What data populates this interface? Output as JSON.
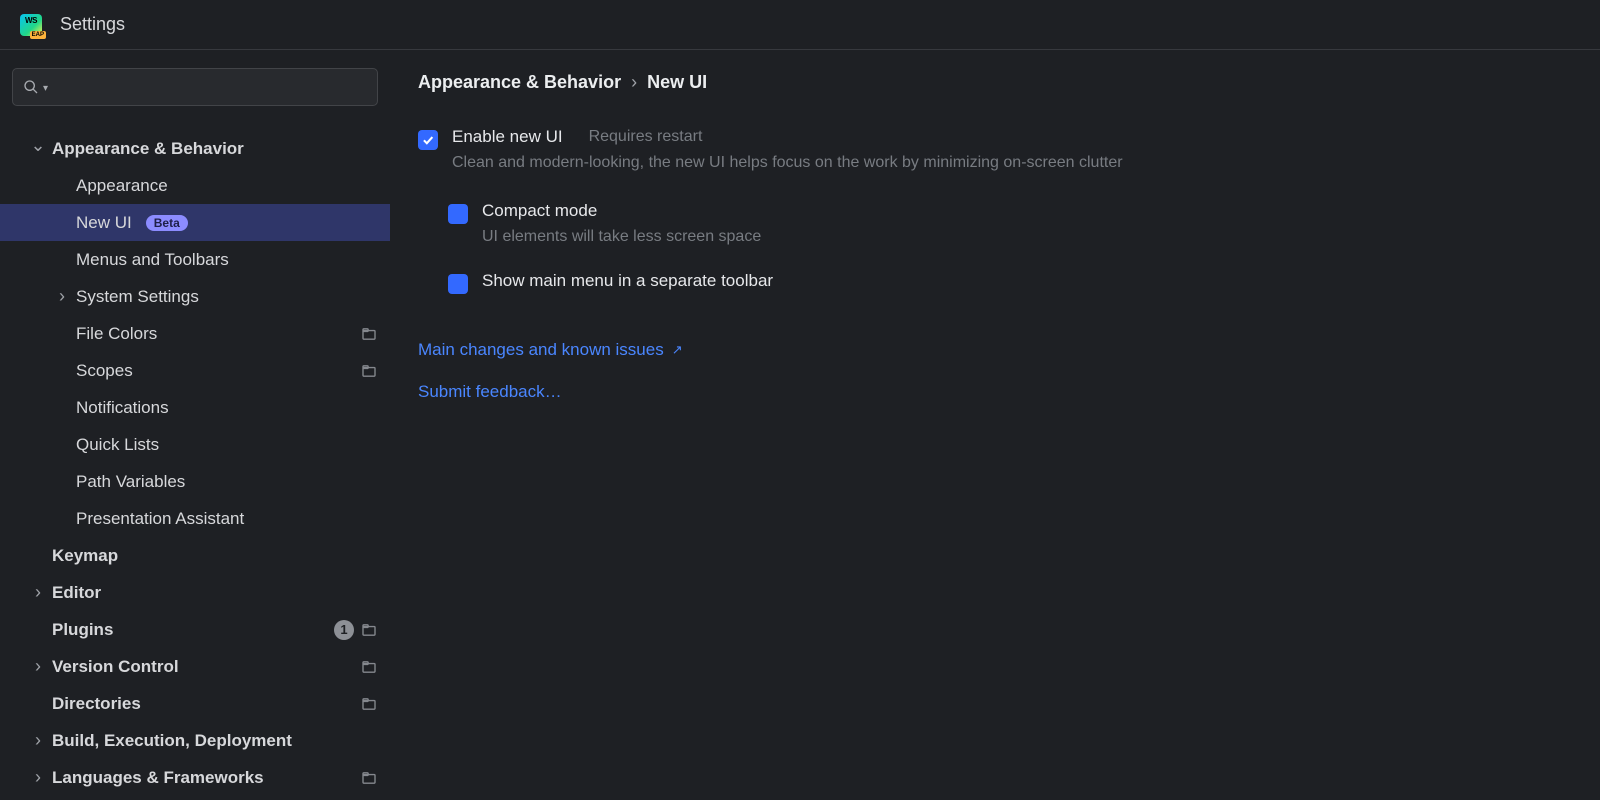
{
  "window": {
    "title": "Settings",
    "app_icon_top": "WS",
    "app_icon_badge": "EAP"
  },
  "search": {
    "placeholder": ""
  },
  "sidebar": {
    "items": [
      {
        "label": "Appearance & Behavior",
        "depth": 0,
        "arrow": "down",
        "bold": true
      },
      {
        "label": "Appearance",
        "depth": 1
      },
      {
        "label": "New UI",
        "depth": 1,
        "selected": true,
        "beta": true
      },
      {
        "label": "Menus and Toolbars",
        "depth": 1
      },
      {
        "label": "System Settings",
        "depth": 1,
        "arrow": "right"
      },
      {
        "label": "File Colors",
        "depth": 1,
        "perProject": true
      },
      {
        "label": "Scopes",
        "depth": 1,
        "perProject": true
      },
      {
        "label": "Notifications",
        "depth": 1
      },
      {
        "label": "Quick Lists",
        "depth": 1
      },
      {
        "label": "Path Variables",
        "depth": 1
      },
      {
        "label": "Presentation Assistant",
        "depth": 1
      },
      {
        "label": "Keymap",
        "depth": 0,
        "bold": true
      },
      {
        "label": "Editor",
        "depth": 0,
        "arrow": "right",
        "bold": true
      },
      {
        "label": "Plugins",
        "depth": 0,
        "bold": true,
        "count": "1",
        "perProject": true
      },
      {
        "label": "Version Control",
        "depth": 0,
        "arrow": "right",
        "bold": true,
        "perProject": true
      },
      {
        "label": "Directories",
        "depth": 0,
        "bold": true,
        "perProject": true
      },
      {
        "label": "Build, Execution, Deployment",
        "depth": 0,
        "arrow": "right",
        "bold": true
      },
      {
        "label": "Languages & Frameworks",
        "depth": 0,
        "arrow": "right",
        "bold": true,
        "perProject": true
      }
    ],
    "beta_label": "Beta"
  },
  "breadcrumb": {
    "parent": "Appearance & Behavior",
    "sep": "›",
    "current": "New UI"
  },
  "options": {
    "enable": {
      "label": "Enable new UI",
      "hint": "Requires restart",
      "desc": "Clean and modern-looking, the new UI helps focus on the work by minimizing on-screen clutter",
      "checked": true
    },
    "compact": {
      "label": "Compact mode",
      "desc": "UI elements will take less screen space",
      "checked": false
    },
    "menu": {
      "label": "Show main menu in a separate toolbar",
      "checked": false
    }
  },
  "links": {
    "changes": "Main changes and known issues",
    "feedback": "Submit feedback…"
  }
}
